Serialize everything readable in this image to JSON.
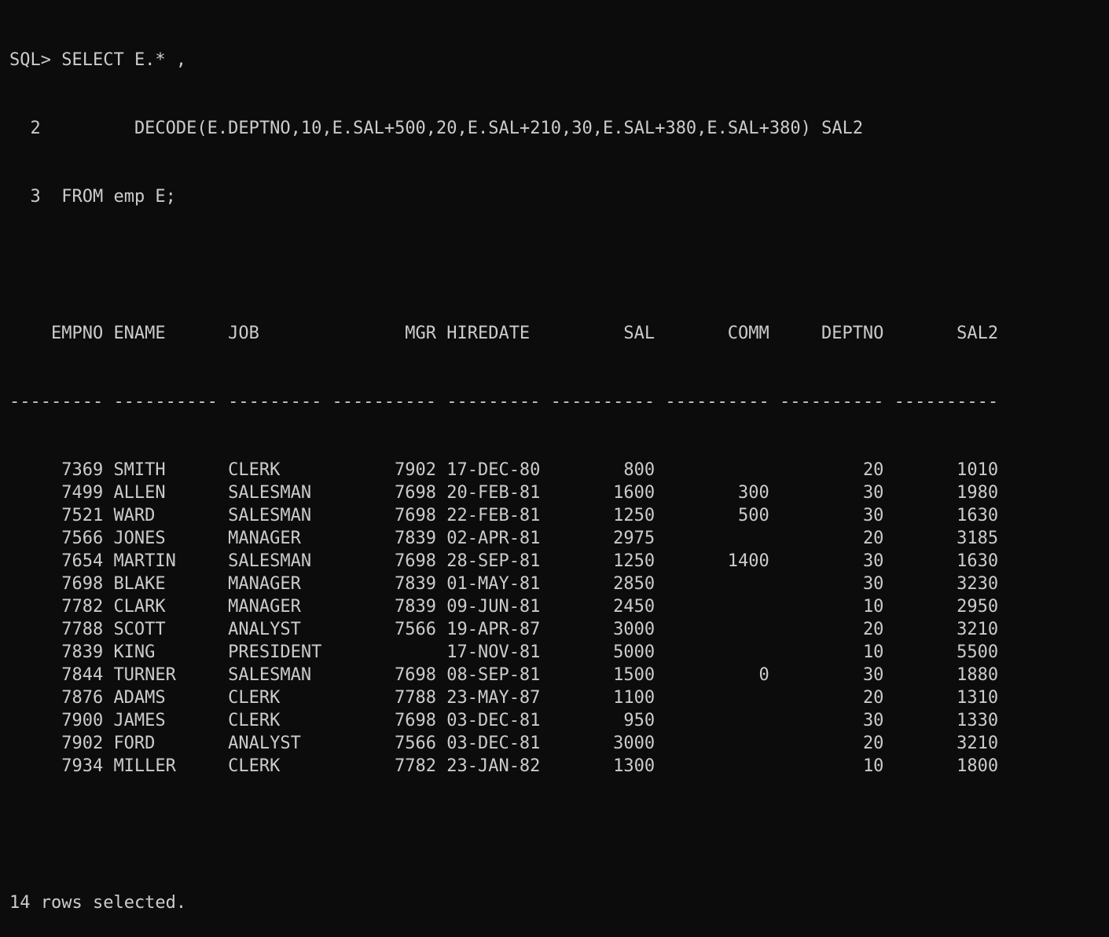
{
  "prompt": "SQL>",
  "query_lines": [
    {
      "num": "",
      "text": "SQL> SELECT E.* ,"
    },
    {
      "num": "2",
      "text": "  2         DECODE(E.DEPTNO,10,E.SAL+500,20,E.SAL+210,30,E.SAL+380,E.SAL+380) SAL2"
    },
    {
      "num": "3",
      "text": "  3  FROM emp E;"
    }
  ],
  "columns": [
    {
      "name": "EMPNO",
      "align": "right",
      "width": 9
    },
    {
      "name": "ENAME",
      "align": "left",
      "width": 10
    },
    {
      "name": "JOB",
      "align": "left",
      "width": 9
    },
    {
      "name": "MGR",
      "align": "right",
      "width": 10
    },
    {
      "name": "HIREDATE",
      "align": "left",
      "width": 9
    },
    {
      "name": "SAL",
      "align": "right",
      "width": 10
    },
    {
      "name": "COMM",
      "align": "right",
      "width": 10
    },
    {
      "name": "DEPTNO",
      "align": "right",
      "width": 10
    },
    {
      "name": "SAL2",
      "align": "right",
      "width": 10
    }
  ],
  "rows": [
    [
      "7369",
      "SMITH",
      "CLERK",
      "7902",
      "17-DEC-80",
      "800",
      "",
      "20",
      "1010"
    ],
    [
      "7499",
      "ALLEN",
      "SALESMAN",
      "7698",
      "20-FEB-81",
      "1600",
      "300",
      "30",
      "1980"
    ],
    [
      "7521",
      "WARD",
      "SALESMAN",
      "7698",
      "22-FEB-81",
      "1250",
      "500",
      "30",
      "1630"
    ],
    [
      "7566",
      "JONES",
      "MANAGER",
      "7839",
      "02-APR-81",
      "2975",
      "",
      "20",
      "3185"
    ],
    [
      "7654",
      "MARTIN",
      "SALESMAN",
      "7698",
      "28-SEP-81",
      "1250",
      "1400",
      "30",
      "1630"
    ],
    [
      "7698",
      "BLAKE",
      "MANAGER",
      "7839",
      "01-MAY-81",
      "2850",
      "",
      "30",
      "3230"
    ],
    [
      "7782",
      "CLARK",
      "MANAGER",
      "7839",
      "09-JUN-81",
      "2450",
      "",
      "10",
      "2950"
    ],
    [
      "7788",
      "SCOTT",
      "ANALYST",
      "7566",
      "19-APR-87",
      "3000",
      "",
      "20",
      "3210"
    ],
    [
      "7839",
      "KING",
      "PRESIDENT",
      "",
      "17-NOV-81",
      "5000",
      "",
      "10",
      "5500"
    ],
    [
      "7844",
      "TURNER",
      "SALESMAN",
      "7698",
      "08-SEP-81",
      "1500",
      "0",
      "30",
      "1880"
    ],
    [
      "7876",
      "ADAMS",
      "CLERK",
      "7788",
      "23-MAY-87",
      "1100",
      "",
      "20",
      "1310"
    ],
    [
      "7900",
      "JAMES",
      "CLERK",
      "7698",
      "03-DEC-81",
      "950",
      "",
      "30",
      "1330"
    ],
    [
      "7902",
      "FORD",
      "ANALYST",
      "7566",
      "03-DEC-81",
      "3000",
      "",
      "20",
      "3210"
    ],
    [
      "7934",
      "MILLER",
      "CLERK",
      "7782",
      "23-JAN-82",
      "1300",
      "",
      "10",
      "1800"
    ]
  ],
  "footer": "14 rows selected.",
  "colors": {
    "background": "#0c0c0c",
    "foreground": "#cccccc"
  }
}
